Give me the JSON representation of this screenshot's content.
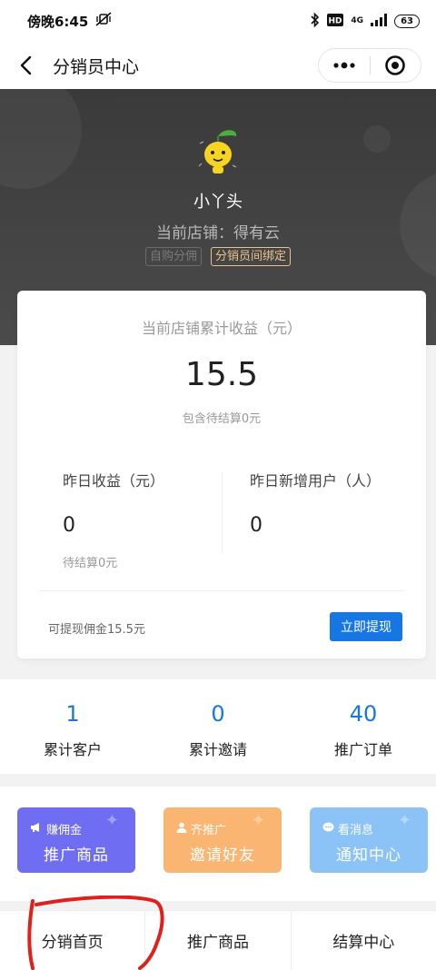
{
  "status_bar": {
    "time": "傍晚6:45",
    "network": "4G",
    "battery": "63",
    "icons": [
      "vibrate-off-icon",
      "bluetooth-icon",
      "hd-icon",
      "signal-icon",
      "battery-icon"
    ]
  },
  "nav": {
    "title": "分销员中心",
    "back_icon": "chevron-left-icon",
    "more_icon": "more-dots-icon",
    "close_icon": "target-circle-icon"
  },
  "profile": {
    "username": "小丫头",
    "shop_line": "当前店铺：得有云",
    "tags": [
      "自购分佣",
      "分销员间绑定"
    ]
  },
  "earnings": {
    "total_label": "当前店铺累计收益（元）",
    "total_value": "15.5",
    "pending_total": "包含待结算0元",
    "yesterday_income_label": "昨日收益（元）",
    "yesterday_income_value": "0",
    "yesterday_pending": "待结算0元",
    "new_users_label": "昨日新增用户（人）",
    "new_users_value": "0",
    "withdrawable": "可提现佣金15.5元",
    "withdraw_button": "立即提现"
  },
  "counts": [
    {
      "value": "1",
      "label": "累计客户"
    },
    {
      "value": "0",
      "label": "累计邀请"
    },
    {
      "value": "40",
      "label": "推广订单"
    }
  ],
  "shortcuts": [
    {
      "tag": "赚佣金",
      "label": "推广商品",
      "icon": "megaphone-icon",
      "color": "#6f6ef3"
    },
    {
      "tag": "齐推广",
      "label": "邀请好友",
      "icon": "user-icon",
      "color": "#fbb572"
    },
    {
      "tag": "看消息",
      "label": "通知中心",
      "icon": "chat-icon",
      "color": "#8cc3f7"
    }
  ],
  "tabs": [
    "分销首页",
    "推广商品",
    "结算中心"
  ],
  "colors": {
    "accent_blue": "#1677e4",
    "hero_dark": "#3a3a3a",
    "gold_tag": "#e9c28a",
    "annotation_red": "#e0201b"
  }
}
